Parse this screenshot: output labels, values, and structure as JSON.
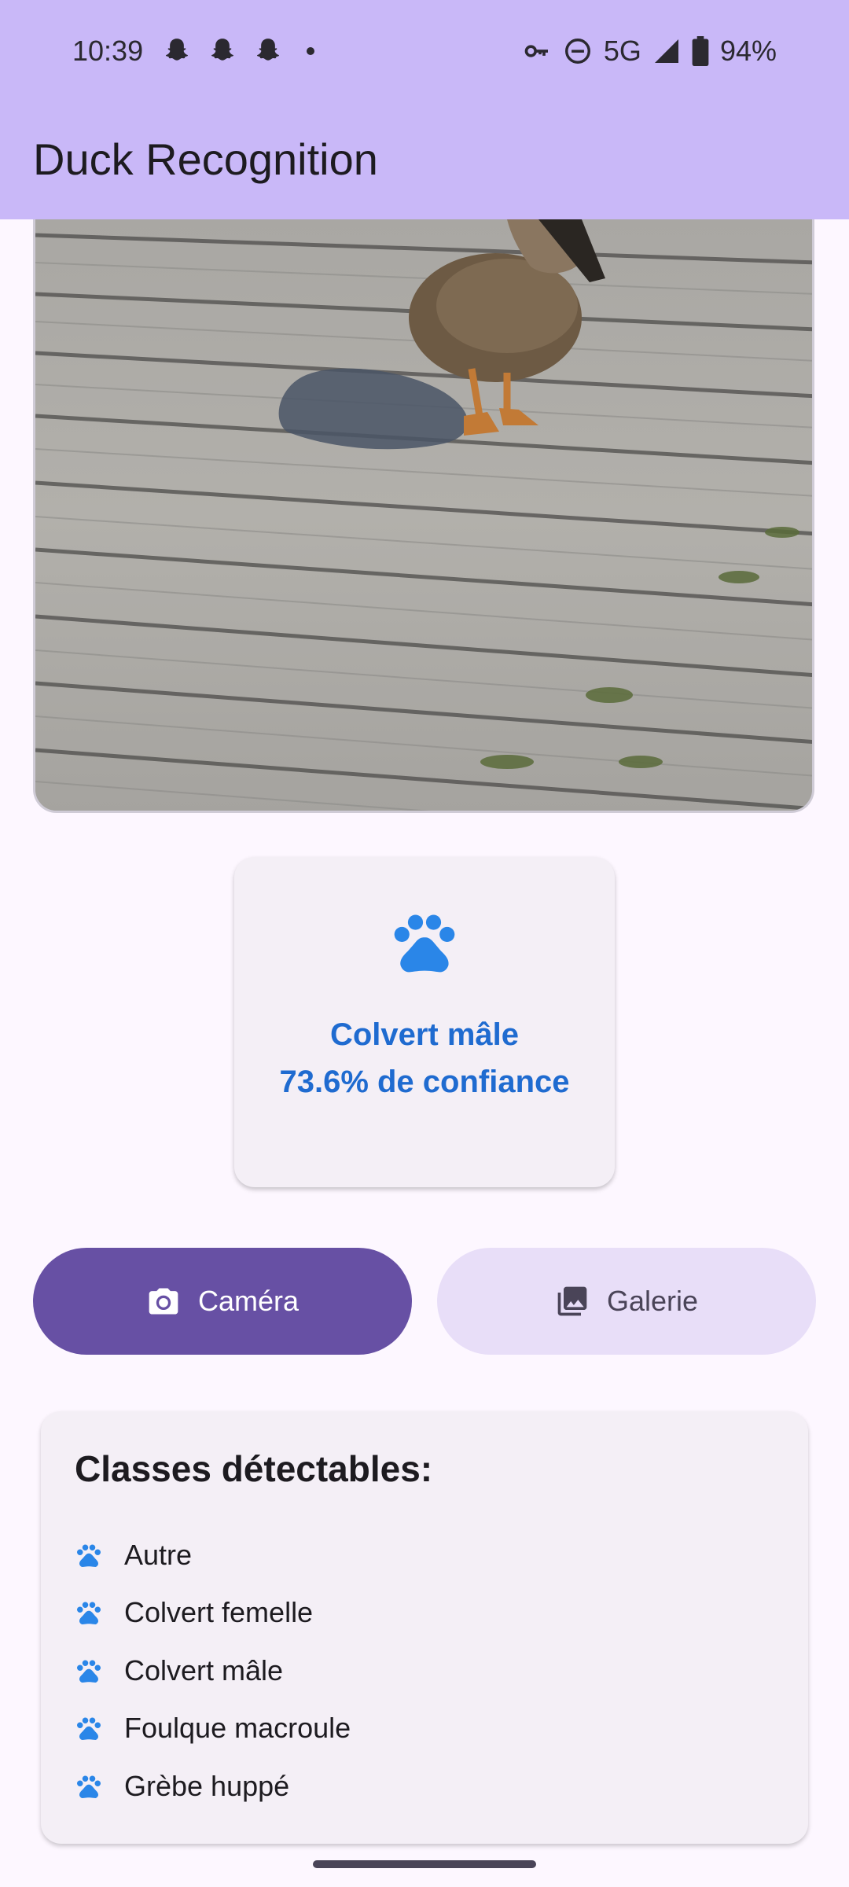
{
  "status_bar": {
    "time": "10:39",
    "notification_icons": [
      "snapchat-ghost-icon",
      "snapchat-ghost-icon",
      "snapchat-ghost-icon",
      "more-notifications-dot-icon"
    ],
    "network": "5G",
    "battery": "94%",
    "system_icons": [
      "vpn-key-icon",
      "do-not-disturb-icon",
      "cellular-signal-icon",
      "battery-icon"
    ]
  },
  "app_bar": {
    "title": "Duck Recognition",
    "background_color": "#c9b8f8"
  },
  "photo": {
    "subject": "duck-on-wooden-boardwalk-image"
  },
  "result": {
    "icon": "paw-icon",
    "label": "Colvert mâle",
    "confidence_text": "73.6% de confiance",
    "text_color": "#1f6bd0"
  },
  "actions": {
    "camera": {
      "label": "Caméra",
      "icon": "camera-icon",
      "background_color": "#6750a4"
    },
    "gallery": {
      "label": "Galerie",
      "icon": "image-gallery-icon",
      "background_color": "#e8def8"
    }
  },
  "classes": {
    "title": "Classes détectables:",
    "icon": "paw-icon",
    "icon_color": "#2a86e8",
    "items": [
      "Autre",
      "Colvert femelle",
      "Colvert mâle",
      "Foulque macroule",
      "Grèbe huppé"
    ]
  }
}
